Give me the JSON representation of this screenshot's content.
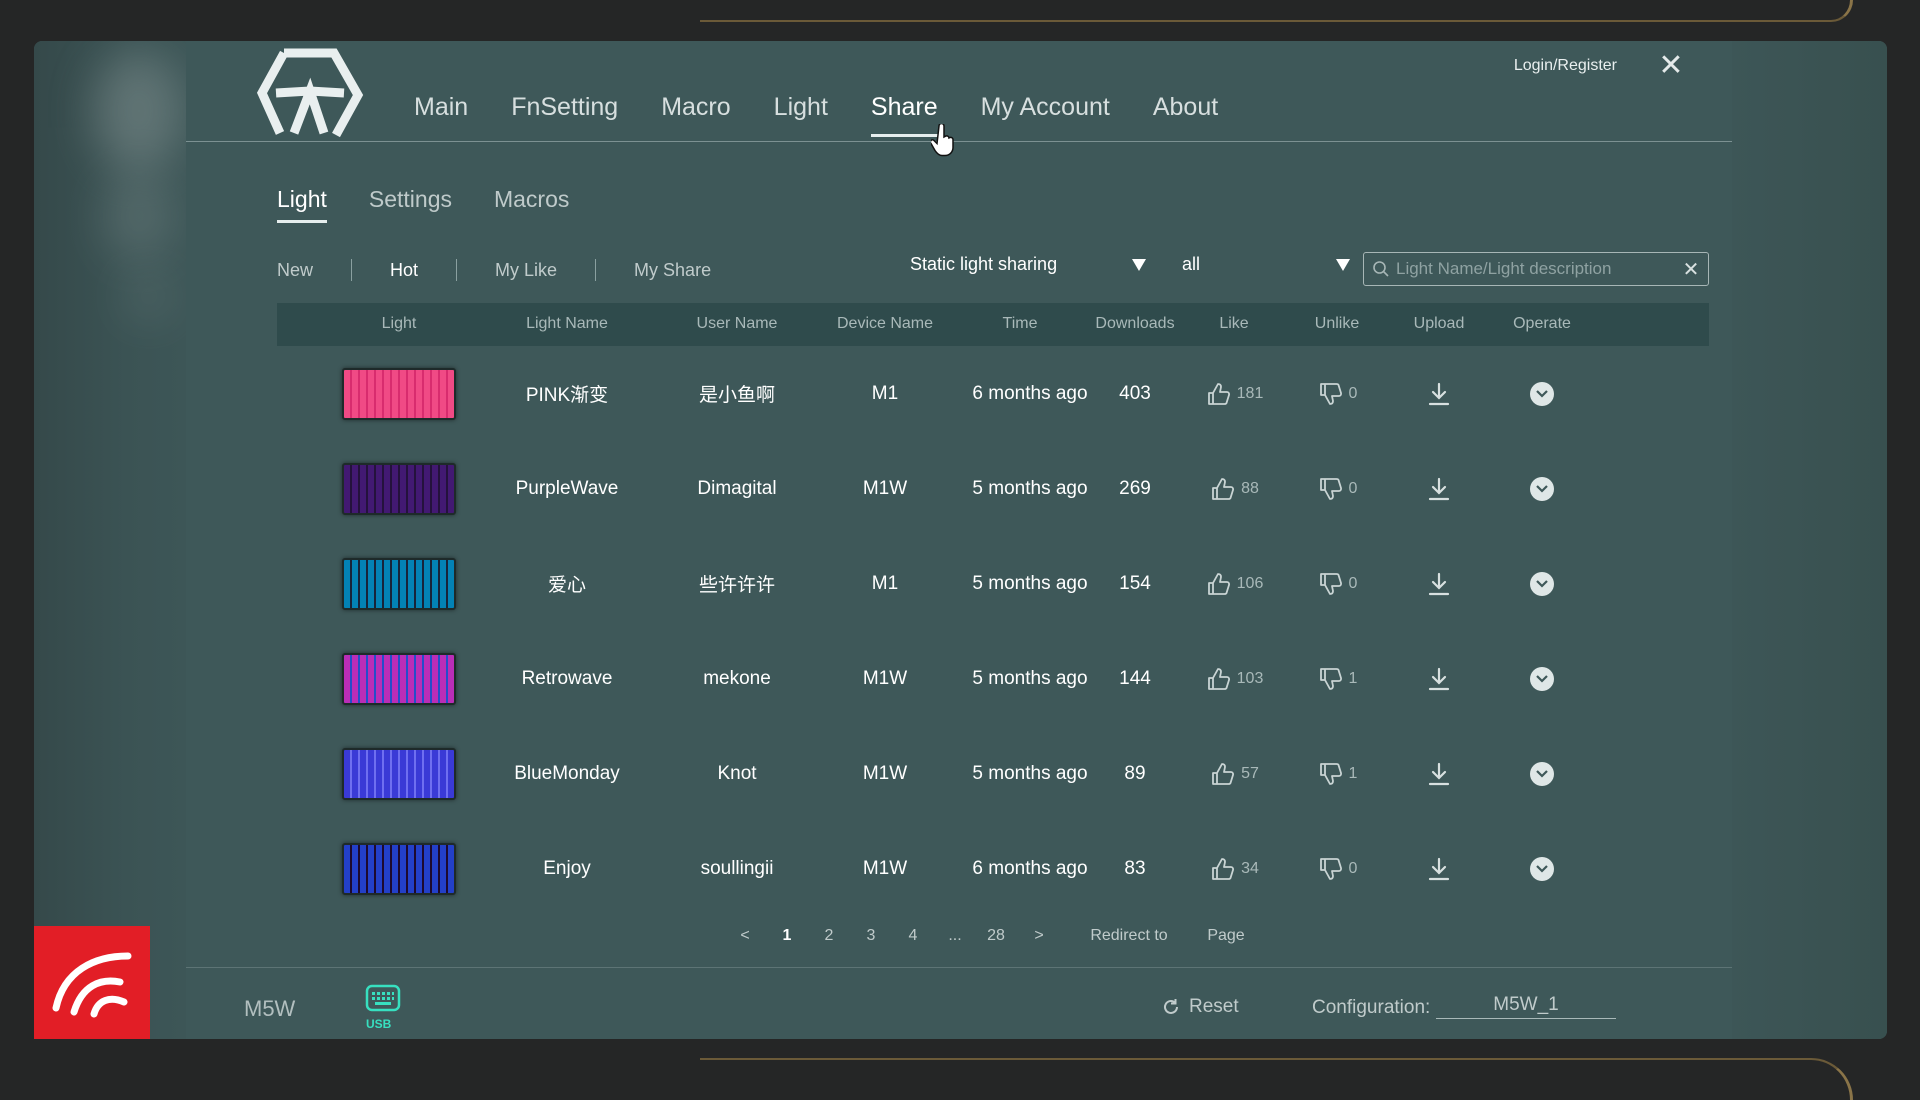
{
  "nav": {
    "items": [
      {
        "label": "Main"
      },
      {
        "label": "FnSetting"
      },
      {
        "label": "Macro"
      },
      {
        "label": "Light"
      },
      {
        "label": "Share",
        "active": true
      },
      {
        "label": "My Account"
      },
      {
        "label": "About"
      }
    ],
    "login_label": "Login/Register",
    "close_icon": "close-icon"
  },
  "subtabs": [
    {
      "label": "Light",
      "active": true
    },
    {
      "label": "Settings"
    },
    {
      "label": "Macros"
    }
  ],
  "filters": [
    {
      "label": "New"
    },
    {
      "label": "Hot",
      "active": true
    },
    {
      "label": "My Like"
    },
    {
      "label": "My Share"
    }
  ],
  "type_select": {
    "value": "Static light sharing"
  },
  "category_select": {
    "value": "all"
  },
  "search": {
    "placeholder": "Light Name/Light description"
  },
  "table": {
    "headers": [
      "Light",
      "Light Name",
      "User Name",
      "Device Name",
      "Time",
      "Downloads",
      "Like",
      "Unlike",
      "Upload",
      "Operate"
    ],
    "rows": [
      {
        "light_name": "PINK渐变",
        "user": "是小鱼啊",
        "device": "M1",
        "time": "6 months ago",
        "downloads": "403",
        "likes": "181",
        "unlikes": "0",
        "thumb_colors": [
          "#f06aa2",
          "#d83f86",
          "#ffb3d1"
        ]
      },
      {
        "light_name": "PurpleWave",
        "user": "Dimagital",
        "device": "M1W",
        "time": "5 months ago",
        "downloads": "269",
        "likes": "88",
        "unlikes": "0",
        "thumb_colors": [
          "#6a3c8c",
          "#3a2a4a",
          "#a06bd0"
        ]
      },
      {
        "light_name": "爱心",
        "user": "些许许许",
        "device": "M1",
        "time": "5 months ago",
        "downloads": "154",
        "likes": "106",
        "unlikes": "0",
        "thumb_colors": [
          "#21c7e6",
          "#e8364a",
          "#1aa7c9"
        ]
      },
      {
        "light_name": "Retrowave",
        "user": "mekone",
        "device": "M1W",
        "time": "5 months ago",
        "downloads": "144",
        "likes": "103",
        "unlikes": "1",
        "thumb_colors": [
          "#f27ad0",
          "#2fd0e6",
          "#c45fe0"
        ]
      },
      {
        "light_name": "BlueMonday",
        "user": "Knot",
        "device": "M1W",
        "time": "5 months ago",
        "downloads": "89",
        "likes": "57",
        "unlikes": "1",
        "thumb_colors": [
          "#3a3ad6",
          "#6f6ff0",
          "#ffffff"
        ]
      },
      {
        "light_name": "Enjoy",
        "user": "soullingii",
        "device": "M1W",
        "time": "6 months ago",
        "downloads": "83",
        "likes": "34",
        "unlikes": "0",
        "thumb_colors": [
          "#ffffff",
          "#d6263a",
          "#2340c8"
        ]
      }
    ]
  },
  "pagination": {
    "prev": "<",
    "pages": [
      "1",
      "2",
      "3",
      "4",
      "...",
      "28"
    ],
    "current": "1",
    "next": ">",
    "redirect_label": "Redirect to",
    "page_label": "Page"
  },
  "footer": {
    "device": "M5W",
    "connection": "USB",
    "reset_label": "Reset",
    "config_label": "Configuration:",
    "config_value": "M5W_1"
  },
  "colors": {
    "panel_bg": "#3e5859",
    "table_header_bg": "#2f4b4c",
    "usb_accent": "#37e0c0",
    "brand_red": "#e21e26"
  }
}
